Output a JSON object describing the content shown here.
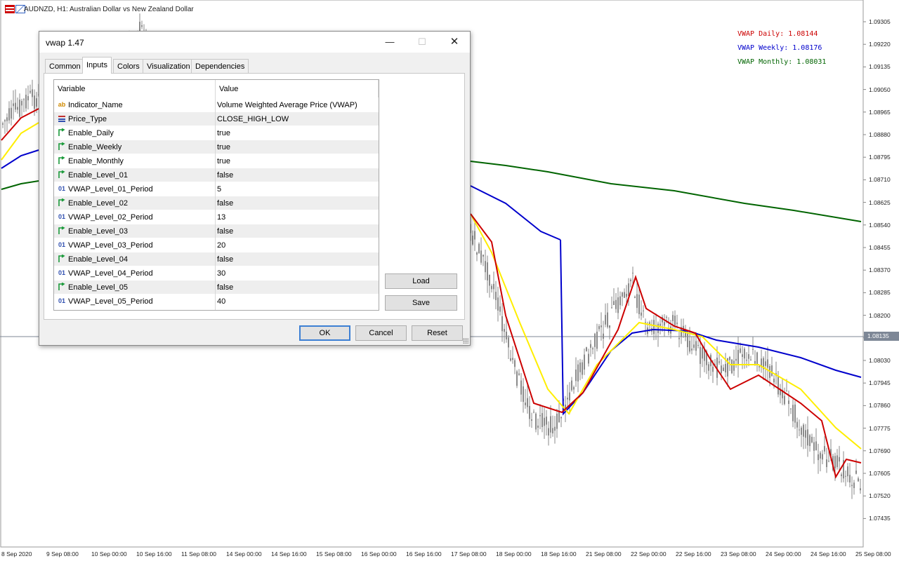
{
  "chart": {
    "title": "AUDNZD, H1:  Australian Dollar vs New Zealand Dollar",
    "vwap_labels": [
      {
        "text": "VWAP Daily: 1.08144",
        "color": "#cc0000"
      },
      {
        "text": "VWAP Weekly: 1.08176",
        "color": "#0000cc"
      },
      {
        "text": "VWAP Monthly: 1.08031",
        "color": "#006400"
      }
    ],
    "price_axis": [
      "1.09305",
      "1.09220",
      "1.09135",
      "1.09050",
      "1.08965",
      "1.08880",
      "1.08795",
      "1.08710",
      "1.08625",
      "1.08540",
      "1.08455",
      "1.08370",
      "1.08285",
      "1.08200",
      "1.08115",
      "1.08030",
      "1.07945",
      "1.07860",
      "1.07775",
      "1.07690",
      "1.07605",
      "1.07520",
      "1.07435"
    ],
    "current_price": "1.08135",
    "time_axis": [
      "8 Sep 2020",
      "9 Sep 08:00",
      "10 Sep 00:00",
      "10 Sep 16:00",
      "11 Sep 08:00",
      "14 Sep 00:00",
      "14 Sep 16:00",
      "15 Sep 08:00",
      "16 Sep 00:00",
      "16 Sep 16:00",
      "17 Sep 08:00",
      "18 Sep 00:00",
      "18 Sep 16:00",
      "21 Sep 08:00",
      "22 Sep 00:00",
      "22 Sep 16:00",
      "23 Sep 08:00",
      "24 Sep 00:00",
      "24 Sep 16:00",
      "25 Sep 08:00"
    ],
    "line_colors": {
      "daily": "#cc0000",
      "weekly": "#0000cc",
      "monthly": "#006400",
      "band": "#ffee00",
      "candles": "#8a8a8a"
    }
  },
  "dialog": {
    "title": "vwap 1.47",
    "tabs": [
      "Common",
      "Inputs",
      "Colors",
      "Visualization",
      "Dependencies"
    ],
    "active_tab": "Inputs",
    "columns": {
      "variable": "Variable",
      "value": "Value"
    },
    "rows": [
      {
        "icon": "text-type-icon",
        "variable": "Indicator_Name",
        "value": "Volume Weighted Average Price (VWAP)"
      },
      {
        "icon": "enum-type-icon",
        "variable": "Price_Type",
        "value": "CLOSE_HIGH_LOW"
      },
      {
        "icon": "bool-type-icon",
        "variable": "Enable_Daily",
        "value": "true"
      },
      {
        "icon": "bool-type-icon",
        "variable": "Enable_Weekly",
        "value": "true"
      },
      {
        "icon": "bool-type-icon",
        "variable": "Enable_Monthly",
        "value": "true"
      },
      {
        "icon": "bool-type-icon",
        "variable": "Enable_Level_01",
        "value": "false"
      },
      {
        "icon": "int-type-icon",
        "variable": "VWAP_Level_01_Period",
        "value": "5"
      },
      {
        "icon": "bool-type-icon",
        "variable": "Enable_Level_02",
        "value": "false"
      },
      {
        "icon": "int-type-icon",
        "variable": "VWAP_Level_02_Period",
        "value": "13"
      },
      {
        "icon": "bool-type-icon",
        "variable": "Enable_Level_03",
        "value": "false"
      },
      {
        "icon": "int-type-icon",
        "variable": "VWAP_Level_03_Period",
        "value": "20"
      },
      {
        "icon": "bool-type-icon",
        "variable": "Enable_Level_04",
        "value": "false"
      },
      {
        "icon": "int-type-icon",
        "variable": "VWAP_Level_04_Period",
        "value": "30"
      },
      {
        "icon": "bool-type-icon",
        "variable": "Enable_Level_05",
        "value": "false"
      },
      {
        "icon": "int-type-icon",
        "variable": "VWAP_Level_05_Period",
        "value": "40"
      }
    ],
    "side_buttons": {
      "load": "Load",
      "save": "Save"
    },
    "footer_buttons": {
      "ok": "OK",
      "cancel": "Cancel",
      "reset": "Reset"
    },
    "icon_glyphs": {
      "text": "ab",
      "int": "01"
    }
  }
}
